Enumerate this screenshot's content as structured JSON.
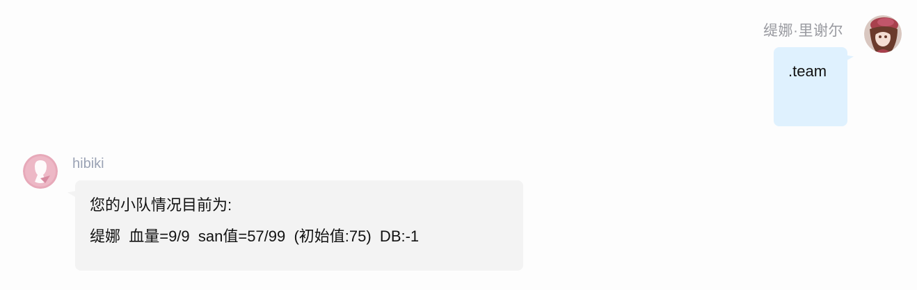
{
  "messages": [
    {
      "side": "right",
      "sender": "缇娜·里谢尔",
      "avatar": "anime-girl-avatar-icon",
      "text": ".team"
    },
    {
      "side": "left",
      "sender": "hibiki",
      "avatar": "pink-silhouette-avatar-icon",
      "lines": [
        "您的小队情况目前为:",
        "缇娜  血量=9/9  san值=57/99  (初始值:75)  DB:-1"
      ]
    }
  ],
  "colors": {
    "right_bubble": "#dff1fe",
    "left_bubble": "#f3f3f3",
    "right_sender": "#999aa0",
    "left_sender": "#9aa2b4",
    "background": "#fdfdfd"
  }
}
